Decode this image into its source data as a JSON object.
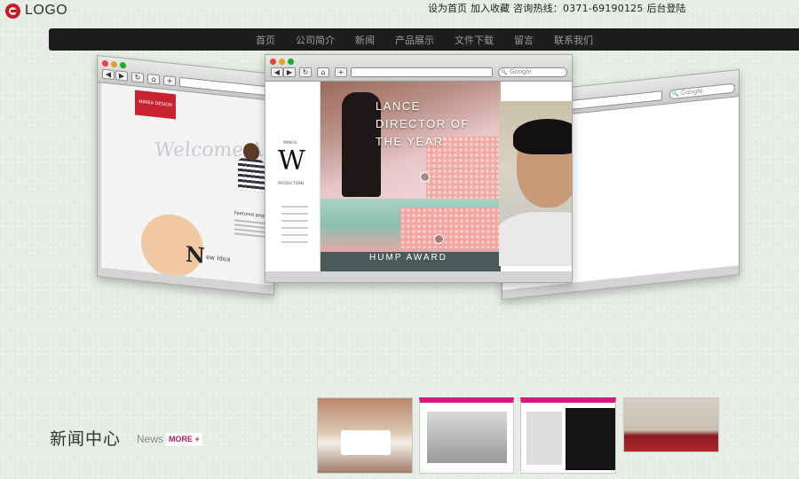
{
  "header": {
    "logo_text": "LOGO",
    "top_links": {
      "set_home": "设为首页",
      "add_favorite": "加入收藏",
      "hotline": "咨询热线：0371-69190125",
      "admin_login": "后台登陆"
    }
  },
  "nav": {
    "items": [
      "首页",
      "公司简介",
      "新闻",
      "产品展示",
      "文件下载",
      "留言",
      "联系我们"
    ]
  },
  "showcase": {
    "search_placeholder": "Google",
    "left_browser": {
      "badge": "MIMEA DESIGN",
      "welcome": "Welcome At",
      "big_letter": "N",
      "idea_text": "ew Idea",
      "featured_label": "Featured project"
    },
    "center_browser": {
      "brand_letter": "W",
      "brand_top": "WANGA",
      "brand_bottom": "PRODUCTIONS",
      "headline_line1": "LANCE",
      "headline_line2": "DIRECTOR OF",
      "headline_line3": "THE YEAR",
      "lower_banner": "HUMP AWARD"
    }
  },
  "news": {
    "title": "新闻中心",
    "title_en": "News",
    "more_label": "MORE +"
  },
  "colors": {
    "accent_red": "#c8182a",
    "nav_bg": "#1d1d1d",
    "more_pink": "#b51c72",
    "thumb_bar": "#e0147a"
  }
}
